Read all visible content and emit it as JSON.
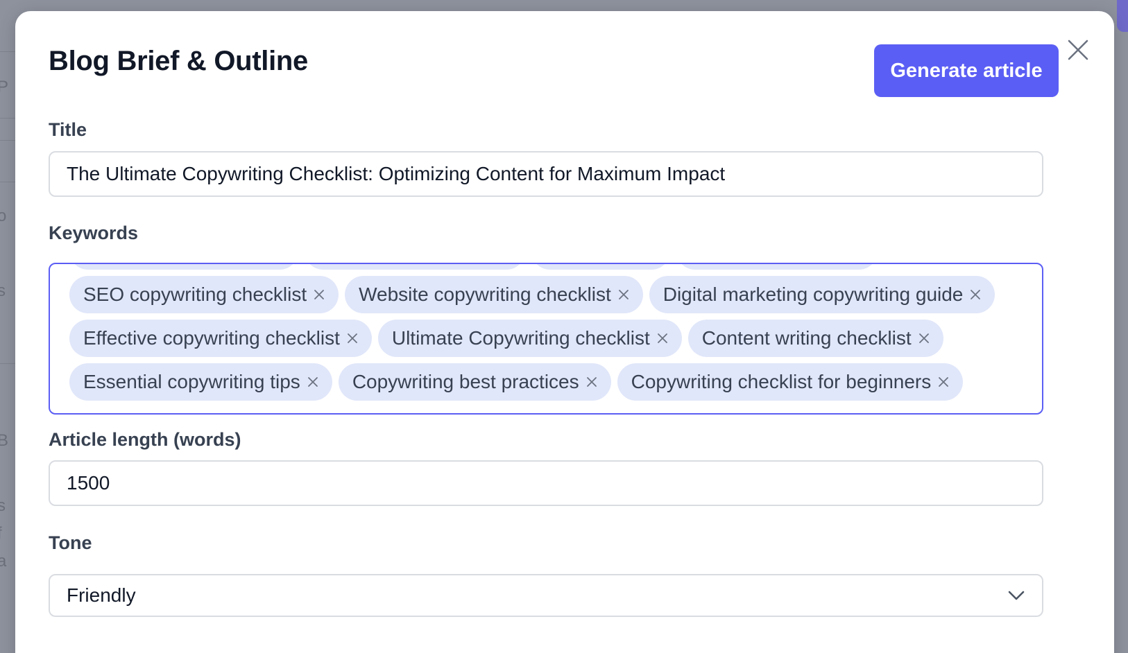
{
  "modal": {
    "title": "Blog Brief & Outline",
    "generate_label": "Generate article",
    "accent_color": "#5b5ef4"
  },
  "fields": {
    "title": {
      "label": "Title",
      "value": "The Ultimate Copywriting Checklist: Optimizing Content for Maximum Impact"
    },
    "keywords": {
      "label": "Keywords",
      "tags": [
        "SEO copywriting checklist",
        "Website copywriting checklist",
        "Digital marketing copywriting guide",
        "Effective copywriting checklist",
        "Ultimate Copywriting checklist",
        "Content writing checklist",
        "Essential copywriting tips",
        "Copywriting best practices",
        "Copywriting checklist for beginners"
      ]
    },
    "article_length": {
      "label": "Article length (words)",
      "value": "1500"
    },
    "tone": {
      "label": "Tone",
      "selected": "Friendly"
    }
  },
  "icons": {
    "close": "close-icon",
    "tag_remove": "x-icon",
    "dropdown": "chevron-down-icon"
  }
}
